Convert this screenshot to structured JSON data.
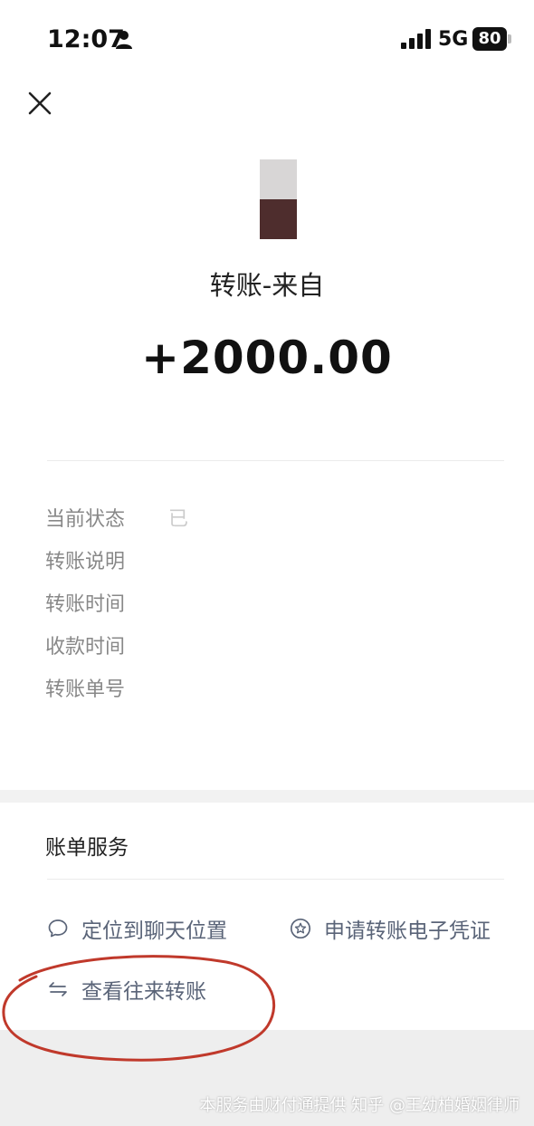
{
  "status_bar": {
    "time": "12:07",
    "network": "5G",
    "battery": "80"
  },
  "header": {
    "close_icon": "close-icon"
  },
  "transfer": {
    "title": "转账-来自",
    "amount": "+2000.00"
  },
  "details": [
    {
      "label": "当前状态",
      "value": "已"
    },
    {
      "label": "转账说明",
      "value": ""
    },
    {
      "label": "转账时间",
      "value": ""
    },
    {
      "label": "收款时间",
      "value": ""
    },
    {
      "label": "转账单号",
      "value": ""
    }
  ],
  "services": {
    "heading": "账单服务",
    "items": [
      {
        "label": "定位到聊天位置",
        "icon": "chat-bubble-icon"
      },
      {
        "label": "申请转账电子凭证",
        "icon": "star-badge-icon"
      },
      {
        "label": "查看往来转账",
        "icon": "exchange-arrows-icon"
      }
    ]
  },
  "footer": {
    "text": "本服务由财付通提供  知乎 @王幼柏婚姻律师"
  },
  "colors": {
    "annotation": "#c0392b",
    "link": "#5a6478",
    "avatar_top": "#d8d6d6",
    "avatar_bottom": "#4e2d2d"
  }
}
